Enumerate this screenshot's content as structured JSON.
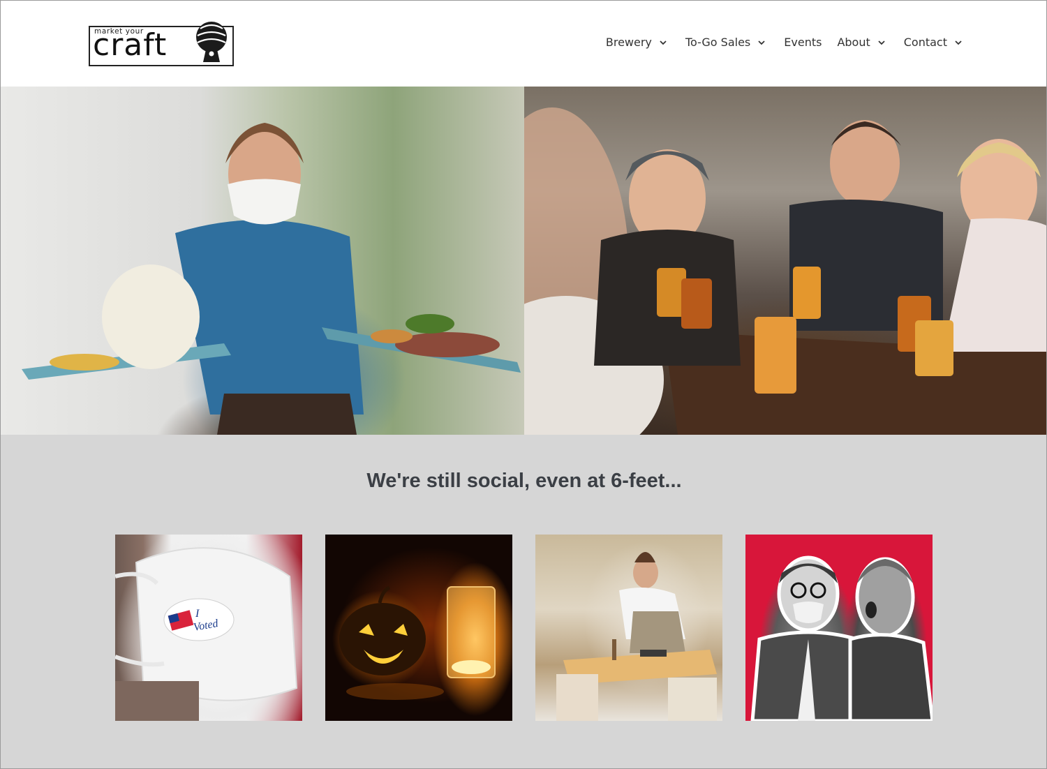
{
  "header": {
    "logo": {
      "small_text": "market your",
      "big_text": "craft"
    },
    "nav": [
      {
        "label": "Brewery",
        "has_dropdown": true
      },
      {
        "label": "To-Go Sales",
        "has_dropdown": true
      },
      {
        "label": "Events",
        "has_dropdown": false
      },
      {
        "label": "About",
        "has_dropdown": true
      },
      {
        "label": "Contact",
        "has_dropdown": true
      }
    ]
  },
  "hero": {
    "left_image": "waitress-serving-food-photo",
    "right_image": "friends-drinking-beer-photo"
  },
  "section": {
    "title": "We're still social, even at 6-feet...",
    "tiles": [
      {
        "name": "voted-mask-photo",
        "sticker_line1": "I",
        "sticker_line2": "Voted"
      },
      {
        "name": "halloween-pumpkin-beer-photo"
      },
      {
        "name": "server-cleaning-table-photo"
      },
      {
        "name": "masked-friends-photo"
      }
    ]
  },
  "colors": {
    "header_bg": "#ffffff",
    "section_bg": "#d6d6d6",
    "title_color": "#3b3f45",
    "nav_text": "#333333",
    "tile4_bg": "#d8163a"
  }
}
